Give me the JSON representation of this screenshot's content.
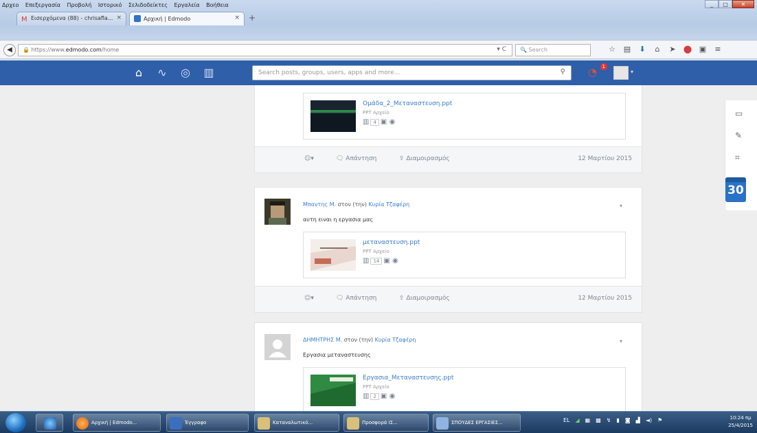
{
  "browser": {
    "menu": [
      "Δρχεο",
      "Επεξεργασία",
      "Προβολή",
      "Ιστορικό",
      "Σελιδοδείκτες",
      "Εργαλεία",
      "Βοήθεια"
    ],
    "tabs": [
      {
        "title": "Εισερχόμενα (88) - chrisafla...",
        "active": false
      },
      {
        "title": "Αρχική | Edmodo",
        "active": true
      }
    ],
    "url_prefix": "https://www.",
    "url_host": "edmodo.com",
    "url_path": "/home",
    "search_placeholder": "Search",
    "new_tab": "+"
  },
  "edmodo": {
    "search_placeholder": "Search posts, groups, users, apps and more...",
    "notification_count": "1"
  },
  "posts": [
    {
      "author": "",
      "attachment": {
        "name": "Ομάδα_2_Μεταναστευση.ppt",
        "type": "PPT Αρχείο",
        "views": "4"
      },
      "reply": "Απάντηση",
      "share": "Διαμοιρασμός",
      "date": "12 Μαρτίου 2015"
    },
    {
      "author": "Μπαντης Μ.",
      "to_prefix": "στον (την)",
      "to_name": "Κυρία Τζαφέρη",
      "text": "αυτη ειναι η εργασια μας",
      "attachment": {
        "name": "μεταναστευση.ppt",
        "type": "PPT Αρχείο",
        "views": "14"
      },
      "reply": "Απάντηση",
      "share": "Διαμοιρασμός",
      "date": "12 Μαρτίου 2015"
    },
    {
      "author": "ΔΗΜΗΤΡΗΣ Μ.",
      "to_prefix": "στον (την)",
      "to_name": "Κυρία Τζαφέρη",
      "text": "Εργασια μεταναστευσης",
      "attachment": {
        "name": "Εργασια_Μεταναστευσης.ppt",
        "type": "PPT Αρχείο",
        "views": "2"
      }
    }
  ],
  "rail": {
    "calendar_day": "30"
  },
  "taskbar": {
    "items": [
      "Αρχική | Edmodo...",
      "Έγγραφο",
      "Καταναλωτικό...",
      "Προσφορά ΙΣ...",
      "ΣΠΟΥΔΕΣ ΕΡΓΑΣΙΕΣ..."
    ],
    "tray_lang": "EL",
    "clock_time": "10:24 πμ",
    "clock_date": "25/4/2015"
  }
}
